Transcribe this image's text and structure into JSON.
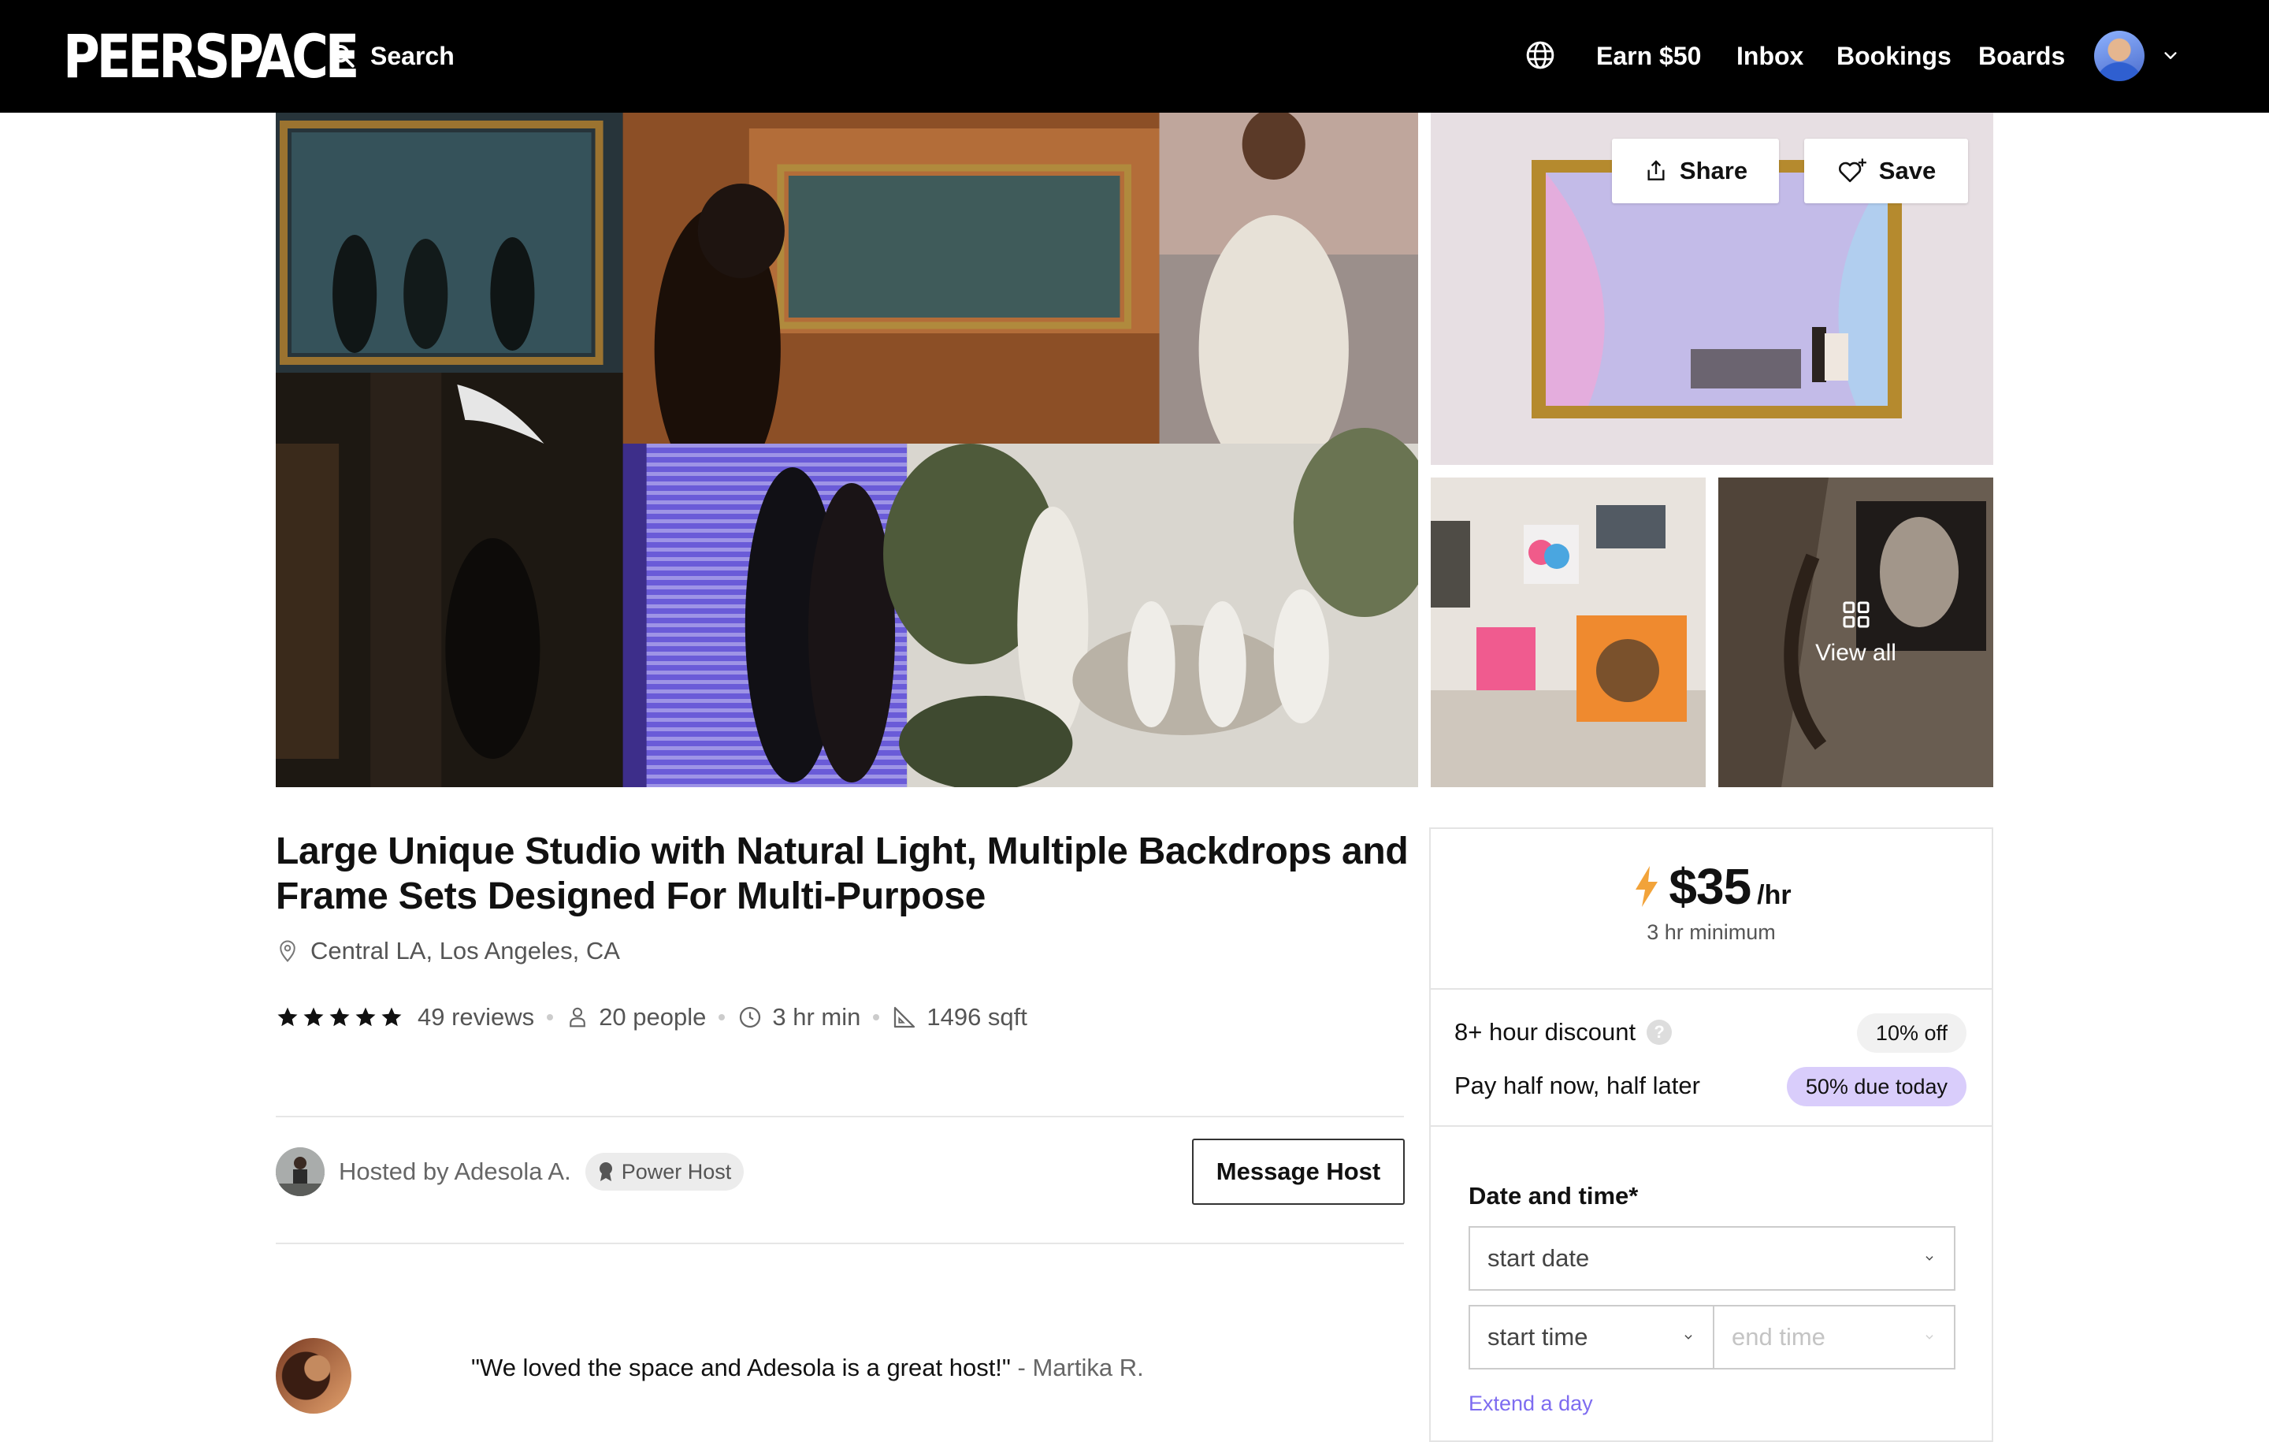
{
  "nav": {
    "logo": "PEERSPACE",
    "search_label": "Search",
    "links": [
      "Earn $50",
      "Inbox",
      "Bookings",
      "Boards"
    ],
    "icons": [
      "globe-icon",
      "avatar",
      "chevron-down-icon"
    ]
  },
  "gallery": {
    "share_label": "Share",
    "save_label": "Save",
    "view_all_label": "View all"
  },
  "listing": {
    "title": "Large Unique Studio with Natural Light, Multiple Backdrops and Frame Sets Designed For Multi-Purpose",
    "location": "Central LA, Los Angeles, CA",
    "rating_stars": 5,
    "reviews": "49 reviews",
    "capacity": "20 people",
    "min_hours": "3 hr min",
    "size": "1496 sqft"
  },
  "host": {
    "hosted_by": "Hosted by Adesola A.",
    "badge": "Power Host",
    "message_button": "Message Host"
  },
  "review": {
    "quote": "\"We loved the space and Adesola is a great host!\"",
    "author": " - Martika R."
  },
  "booking": {
    "price": "$35",
    "unit": "/hr",
    "minimum": "3 hr minimum",
    "discount_label": "8+ hour discount",
    "discount_help": "?",
    "discount_value": "10% off",
    "split_label": "Pay half now, half later",
    "split_value": "50% due today",
    "date_time_label": "Date and time*",
    "start_date": "start date",
    "start_time": "start time",
    "end_time": "end time",
    "extend": "Extend a day"
  },
  "colors": {
    "nav_bg": "#000000",
    "accent_purple": "#d9cdfb",
    "link_purple": "#7e6cf0",
    "bolt": "#f2a33a"
  }
}
